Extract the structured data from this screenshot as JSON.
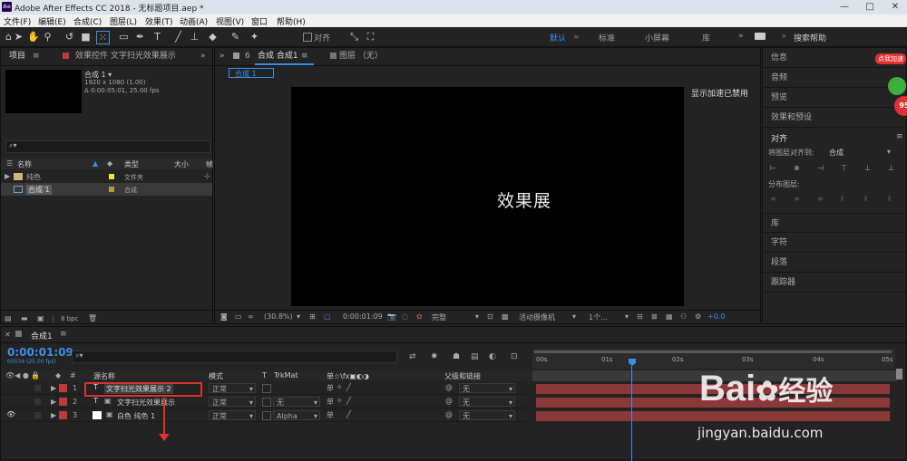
{
  "window": {
    "title": "Adobe After Effects CC 2018 - 无标题项目.aep *",
    "logo": "Ae",
    "controls": [
      "—",
      "□",
      "✕"
    ]
  },
  "menu": [
    "文件(F)",
    "编辑(E)",
    "合成(C)",
    "图层(L)",
    "效果(T)",
    "动画(A)",
    "视图(V)",
    "窗口",
    "帮助(H)"
  ],
  "toolbar": {
    "align_label": "对齐",
    "workspaces": [
      "默认",
      "标准",
      "小屏幕",
      "库"
    ],
    "search_placeholder": "搜索帮助",
    "more": "»"
  },
  "project": {
    "tab_label": "项目",
    "effects_tab": "效果控件 文字扫光效果展示",
    "comp_name": "合成 1 ▾",
    "comp_size": "1920 x 1080 (1.00)",
    "comp_duration": "Δ 0:00:05:01, 25.00 fps",
    "columns": {
      "name": "名称",
      "type": "类型",
      "size": "大小",
      "extra": "帧"
    },
    "rows": [
      {
        "name": "纯色",
        "type": "文件夹",
        "color": "#e8e83a"
      },
      {
        "name": "合成 1",
        "type": "合成",
        "color": "#b59a52"
      }
    ],
    "bpc": "8 bpc"
  },
  "composition": {
    "tab_label": "合成 合成1",
    "layer_tab": "图层 （无）",
    "sub_tab": "合成 1",
    "viewer_text": "效果展",
    "accel_text": "显示加速已禁用",
    "zoom": "(30.8%)",
    "timecode": "0:00:01:09",
    "quality": "完整",
    "camera": "活动摄像机",
    "views": "1个...",
    "exposure": "+0.0"
  },
  "right_panel": {
    "top_items": [
      "信息",
      "音频",
      "预览",
      "效果和预设"
    ],
    "align_title": "对齐",
    "align_to_label": "将图层对齐到:",
    "align_to_value": "合成",
    "distribute_label": "分布图层:",
    "bottom_items": [
      "库",
      "字符",
      "段落",
      "跟踪器"
    ],
    "badge_text": "点我加速",
    "badge_number": "95"
  },
  "timeline": {
    "tab_label": "合成1",
    "timecode": "0:00:01:09",
    "frame_info": "00034 (25.00 fps)",
    "columns": {
      "source": "源名称",
      "mode": "模式",
      "t": "T",
      "trkmat": "TrkMat",
      "switches": "单☆\\fx▣◐◑",
      "parent": "父级和链接"
    },
    "ruler": [
      "00s",
      "01s",
      "02s",
      "03s",
      "04s",
      "05s"
    ],
    "layers": [
      {
        "num": "1",
        "name": "文字扫光效果展示 2",
        "mode": "正常",
        "trkmat": "",
        "parent": "无",
        "color": "#c0393b",
        "kind": "T"
      },
      {
        "num": "2",
        "name": "文字扫光效果展示",
        "mode": "正常",
        "trkmat": "无",
        "parent": "无",
        "color": "#c0393b",
        "kind": "T"
      },
      {
        "num": "3",
        "name": "白色 纯色 1",
        "mode": "正常",
        "trkmat": "Alpha",
        "parent": "无",
        "color": "#c0393b",
        "kind": "solid"
      }
    ],
    "trkmat_none": "无"
  },
  "watermark": {
    "brand": "Bai",
    "brand_suffix": "经验",
    "url": "jingyan.baidu.com"
  },
  "colors": {
    "accent": "#3d8ee8",
    "highlight": "#e03030",
    "layer_bar": "#8b3838"
  }
}
